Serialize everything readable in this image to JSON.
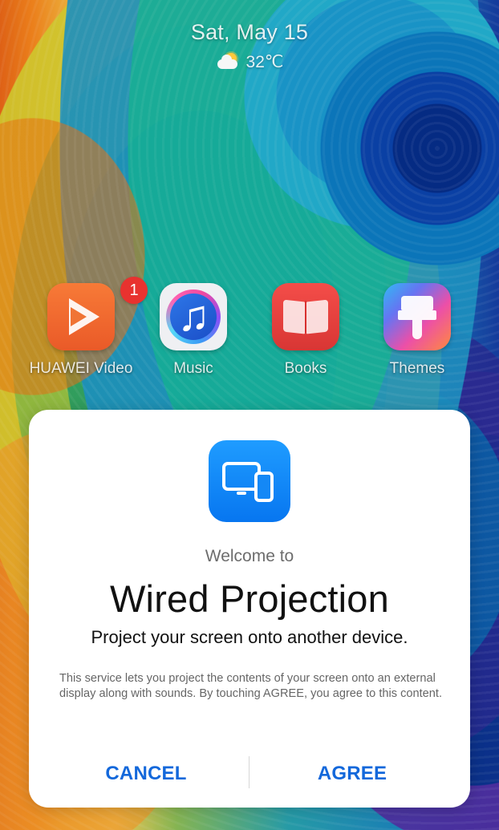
{
  "lock_screen": {
    "date": "Sat, May 15",
    "weather": {
      "icon": "partly-cloudy-icon",
      "temperature": "32℃"
    }
  },
  "apps": [
    {
      "name": "HUAWEI Video",
      "icon": "video-play-icon",
      "badge": "1",
      "accent": "#f07435"
    },
    {
      "name": "Music",
      "icon": "music-note-icon",
      "accent": "#2d77e8"
    },
    {
      "name": "Books",
      "icon": "open-book-icon",
      "accent": "#e83f3c"
    },
    {
      "name": "Themes",
      "icon": "paint-brush-icon",
      "accent": "#6674f2"
    }
  ],
  "dialog": {
    "icon": "projection-icon",
    "welcome": "Welcome to",
    "title": "Wired Projection",
    "subtitle": "Project your screen onto another device.",
    "description": "This service lets you project the contents of your screen onto an external display along with sounds. By touching AGREE, you agree to this content.",
    "actions": {
      "cancel": "CANCEL",
      "agree": "AGREE"
    },
    "colors": {
      "action": "#1368db",
      "icon_background": "#0b86f5"
    }
  }
}
